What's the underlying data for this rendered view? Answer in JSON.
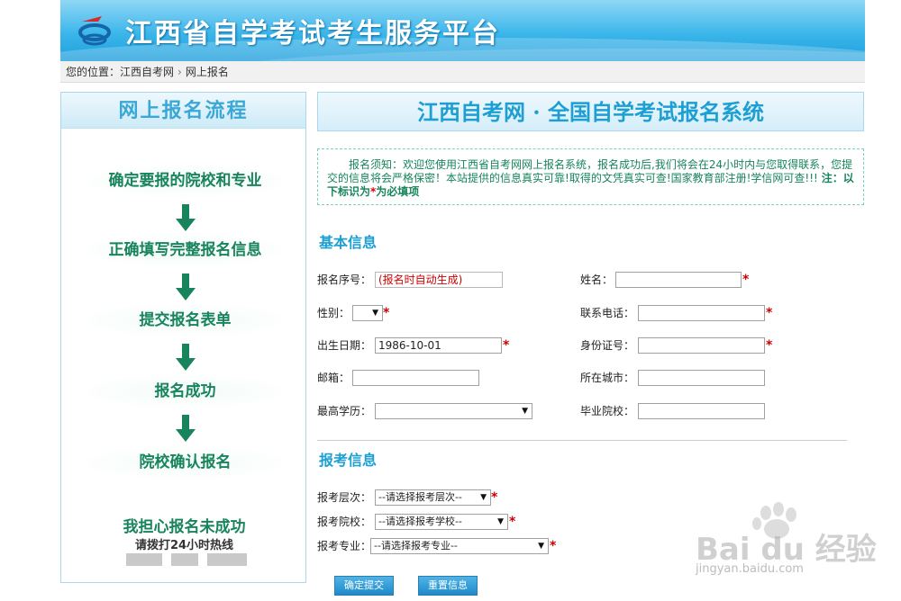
{
  "header": {
    "site_title": "江西省自学考试考生服务平台"
  },
  "breadcrumb": {
    "prefix": "您的位置：",
    "items": [
      "江西自考网",
      "网上报名"
    ],
    "separator": "›"
  },
  "process": {
    "title": "网上报名流程",
    "steps": [
      "确定要报的院校和专业",
      "正确填写完整报名信息",
      "提交报名表单",
      "报名成功",
      "院校确认报名"
    ],
    "worry": "我担心报名未成功",
    "hotline": "请拨打24小时热线"
  },
  "form": {
    "system_title": "江西自考网 · 全国自学考试报名系统",
    "notice": "报名须知：欢迎您使用江西省自考网网上报名系统，报名成功后,我们将会在24小时内与您取得联系，您提交的信息将会严格保密！本站提供的信息真实可靠!取得的文凭真实可查!国家教育部注册!学信网可查!!!",
    "notice_bold": "注：以下标识为",
    "notice_star": "*",
    "notice_tail": "为必填项",
    "basic_title": "基本信息",
    "exam_title": "报考信息",
    "fields": {
      "serial_label": "报名序号：",
      "serial_value": "(报名时自动生成)",
      "name_label": "姓名：",
      "name_value": "",
      "gender_label": "性别：",
      "gender_value": "",
      "phone_label": "联系电话：",
      "phone_value": "",
      "birth_label": "出生日期：",
      "birth_value": "1986-10-01",
      "idcard_label": "身份证号：",
      "idcard_value": "",
      "email_label": "邮箱：",
      "email_value": "",
      "city_label": "所在城市：",
      "city_value": "",
      "edu_label": "最高学历：",
      "edu_value": "",
      "school_label": "毕业院校：",
      "school_value": "",
      "level_label": "报考层次：",
      "level_value": "--请选择报考层次--",
      "college_label": "报考院校：",
      "college_value": "--请选择报考学校--",
      "major_label": "报考专业：",
      "major_value": "--请选择报考专业--"
    },
    "required_mark": "*",
    "submit_label": "确定提交",
    "reset_label": "重置信息"
  },
  "watermark": {
    "brand": "Bai du 经验",
    "url": "jingyan.baidu.com"
  },
  "colors": {
    "accent_blue": "#1d9fd3",
    "accent_green": "#17845c",
    "required_red": "#cc0000"
  }
}
